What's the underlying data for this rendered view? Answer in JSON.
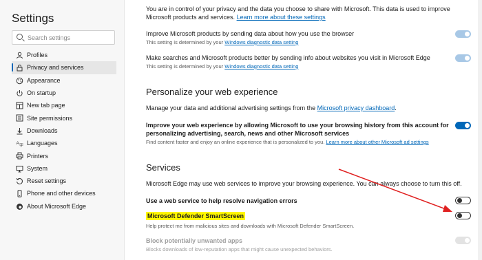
{
  "sidebar": {
    "title": "Settings",
    "search_placeholder": "Search settings",
    "items": [
      {
        "label": "Profiles",
        "icon": "person-icon"
      },
      {
        "label": "Privacy and services",
        "icon": "lock-icon",
        "active": true
      },
      {
        "label": "Appearance",
        "icon": "palette-icon"
      },
      {
        "label": "On startup",
        "icon": "power-icon"
      },
      {
        "label": "New tab page",
        "icon": "grid-icon"
      },
      {
        "label": "Site permissions",
        "icon": "permissions-icon"
      },
      {
        "label": "Downloads",
        "icon": "download-icon"
      },
      {
        "label": "Languages",
        "icon": "language-icon"
      },
      {
        "label": "Printers",
        "icon": "printer-icon"
      },
      {
        "label": "System",
        "icon": "computer-icon"
      },
      {
        "label": "Reset settings",
        "icon": "reset-icon"
      },
      {
        "label": "Phone and other devices",
        "icon": "phone-icon"
      },
      {
        "label": "About Microsoft Edge",
        "icon": "edge-icon"
      }
    ]
  },
  "main": {
    "intro_text": "You are in control of your privacy and the data you choose to share with Microsoft. This data is used to improve Microsoft products and services.",
    "intro_link": "Learn more about these settings",
    "improve_title": "Improve Microsoft products by sending data about how you use the browser",
    "improve_note": "This setting is determined by your",
    "improve_link": "Windows diagnostic data setting",
    "searches_title": "Make searches and Microsoft products better by sending info about websites you visit in Microsoft Edge",
    "searches_note": "This setting is determined by your",
    "searches_link": "Windows diagnostic data setting",
    "personalize_heading": "Personalize your web experience",
    "personalize_desc": "Manage your data and additional advertising settings from the",
    "personalize_link": "Microsoft privacy dashboard",
    "personalize_desc_end": ".",
    "personalize_title": "Improve your web experience by allowing Microsoft to use your browsing history from this account for personalizing advertising, search, news and other Microsoft services",
    "personalize_note": "Find content faster and enjoy an online experience that is personalized to you.",
    "personalize_note_link": "Learn more about other Microsoft ad settings",
    "services_heading": "Services",
    "services_desc": "Microsoft Edge may use web services to improve your browsing experience. You can always choose to turn this off.",
    "nav_errors_title": "Use a web service to help resolve navigation errors",
    "smartscreen_title": "Microsoft Defender SmartScreen",
    "smartscreen_note": "Help protect me from malicious sites and downloads with Microsoft Defender SmartScreen.",
    "pua_title": "Block potentially unwanted apps",
    "pua_note": "Blocks downloads of low-reputation apps that might cause unexpected behaviors."
  },
  "colors": {
    "accent": "#0067b8",
    "highlight": "#fff700",
    "arrow": "#e02020"
  }
}
